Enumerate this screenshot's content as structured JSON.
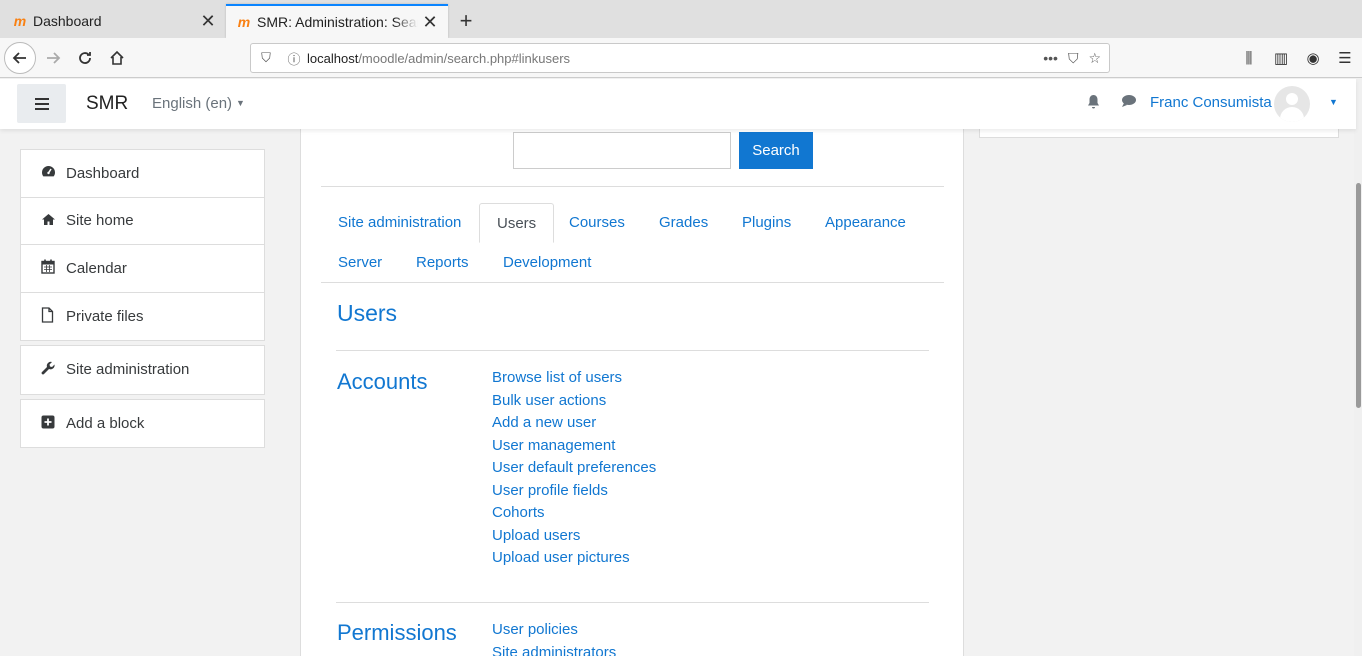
{
  "browser": {
    "tabs": [
      {
        "title": "Dashboard",
        "active": false,
        "favicon": "moodle-m-icon"
      },
      {
        "title": "SMR: Administration: Search",
        "active": true,
        "favicon": "moodle-m-icon"
      }
    ],
    "url_host": "localhost",
    "url_path": "/moodle/admin/search.php#linkusers"
  },
  "header": {
    "brand": "SMR",
    "language": "English (en)",
    "user_name": "Franc Consumista"
  },
  "sidebar": {
    "group1": [
      {
        "label": "Dashboard",
        "icon": "tachometer-icon"
      },
      {
        "label": "Site home",
        "icon": "home-icon"
      },
      {
        "label": "Calendar",
        "icon": "calendar-icon"
      },
      {
        "label": "Private files",
        "icon": "file-icon"
      }
    ],
    "group2": [
      {
        "label": "Site administration",
        "icon": "wrench-icon"
      }
    ],
    "group3": [
      {
        "label": "Add a block",
        "icon": "plus-square-icon"
      }
    ]
  },
  "main": {
    "search_input_value": "",
    "search_button": "Search",
    "tabs": [
      "Site administration",
      "Users",
      "Courses",
      "Grades",
      "Plugins",
      "Appearance",
      "Server",
      "Reports",
      "Development"
    ],
    "active_tab": "Users",
    "section_title": "Users",
    "categories": [
      {
        "title": "Accounts",
        "links": [
          "Browse list of users",
          "Bulk user actions",
          "Add a new user",
          "User management",
          "User default preferences",
          "User profile fields",
          "Cohorts",
          "Upload users",
          "Upload user pictures"
        ]
      },
      {
        "title": "Permissions",
        "links": [
          "User policies",
          "Site administrators"
        ]
      }
    ]
  },
  "colors": {
    "link": "#1177d1",
    "button": "#1177d1",
    "tab_accent": "#0a84ff"
  }
}
